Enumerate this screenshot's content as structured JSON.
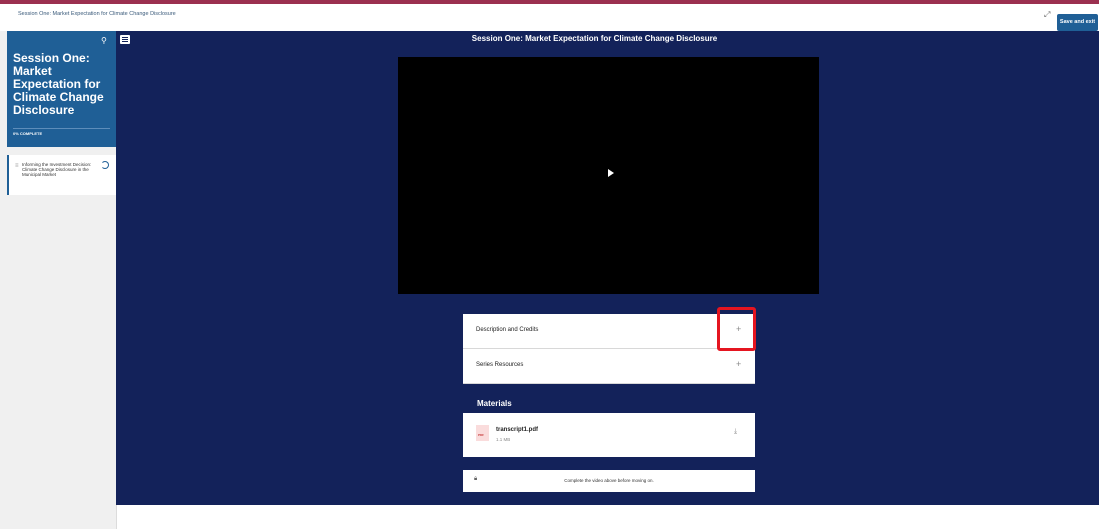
{
  "window": {
    "breadcrumb": "Session One: Market Expectation for Climate Change Disclosure",
    "save_label": "Save and exit"
  },
  "sidebar": {
    "title": "Session One: Market Expectation for Climate Change Disclosure",
    "progress": "0% COMPLETE",
    "lessons": [
      {
        "label": "Informing the Investment Decision: Climate Change Disclosure in the Municipal Market"
      }
    ]
  },
  "main": {
    "title": "Session One: Market Expectation for Climate Change Disclosure",
    "accordions": [
      {
        "label": "Description and Credits"
      },
      {
        "label": "Series Resources"
      }
    ],
    "materials_heading": "Materials",
    "files": [
      {
        "name": "transcript1.pdf",
        "size": "1.1 MB",
        "type": "PDF"
      }
    ],
    "lock_message": "Complete the video above before moving on."
  },
  "icons": [
    "search-icon",
    "menu-icon",
    "expand-icon",
    "play-icon",
    "plus-icon",
    "download-icon",
    "lock-icon",
    "progress-ring-icon",
    "lesson-type-icon",
    "pdf-file-icon"
  ],
  "colors": {
    "brand": "#1f5f96",
    "main_bg": "#13225a",
    "top_accent": "#9b3050",
    "highlight": "#e51520"
  }
}
